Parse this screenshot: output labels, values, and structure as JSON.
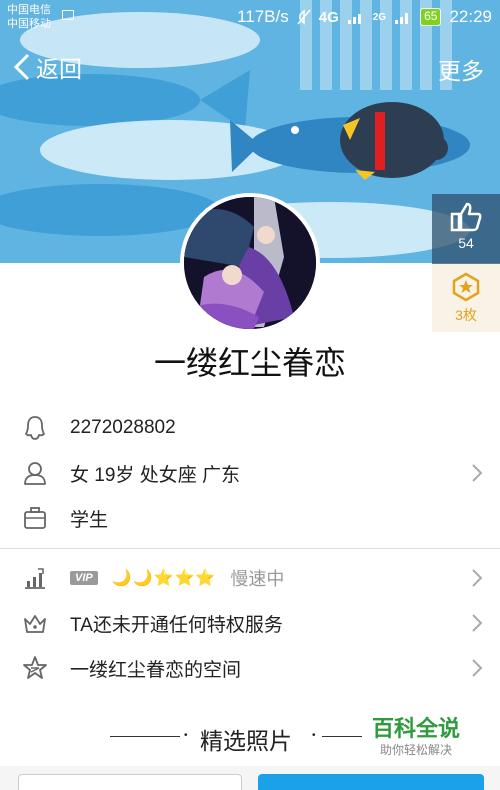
{
  "status_bar": {
    "carrier_1": "中国电信",
    "carrier_2": "中国移动",
    "speed": "117B/s",
    "network": "4G",
    "signal_2g": "2G",
    "battery": "65",
    "time": "22:29"
  },
  "nav": {
    "back_label": "返回",
    "more_label": "更多"
  },
  "side": {
    "likes": "54",
    "medals": "3枚"
  },
  "profile": {
    "nickname": "一缕红尘眷恋",
    "qq_number": "2272028802",
    "basic_info": "女  19岁  处女座  广东",
    "occupation": "学生",
    "vip_badge": "VIP",
    "level_icons": "🌙🌙⭐⭐⭐",
    "level_status": "慢速中",
    "privilege": "TA还未开通任何特权服务",
    "space": "一缕红尘眷恋的空间"
  },
  "section": {
    "photos_title": "精选照片"
  },
  "watermark": {
    "brand": "百科全说",
    "slogan": "助你轻松解决"
  },
  "colors": {
    "banner_bg": "#5fb4e2",
    "primary_button": "#1aa1e8",
    "medal": "#e5a220"
  }
}
